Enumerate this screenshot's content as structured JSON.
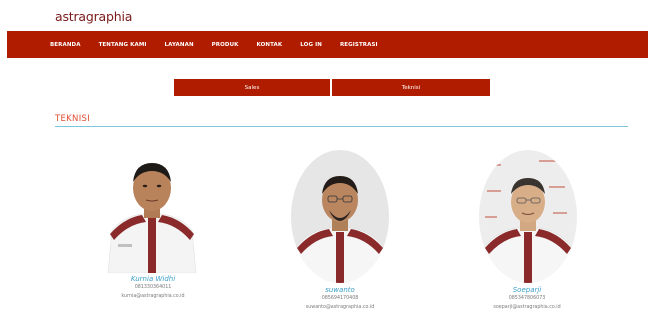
{
  "brand": {
    "logo_text": "astragraphia"
  },
  "nav": {
    "items": [
      {
        "label": "BERANDA"
      },
      {
        "label": "TENTANG KAMI"
      },
      {
        "label": "LAYANAN"
      },
      {
        "label": "PRODUK"
      },
      {
        "label": "KONTAK"
      },
      {
        "label": "LOG IN"
      },
      {
        "label": "REGISTRASI"
      }
    ]
  },
  "tabs": {
    "sales_label": "Sales",
    "teknisi_label": "Teknisi"
  },
  "section": {
    "title": "TEKNISI"
  },
  "colors": {
    "brand_red": "#b01c00",
    "title_orange": "#e04e30",
    "rule_blue": "#7fc6dc",
    "name_blue": "#3a9fc7"
  },
  "people": [
    {
      "name": "Kurnia Widhi",
      "phone": "081330364011",
      "email": "kurnia@astragraphia.co.id"
    },
    {
      "name": "suwanto",
      "phone": "085694170408",
      "email": "suwanto@astragraphia.co.id"
    },
    {
      "name": "Soeparji",
      "phone": "085347806073",
      "email": "soeparji@astragraphia.co.id"
    }
  ]
}
